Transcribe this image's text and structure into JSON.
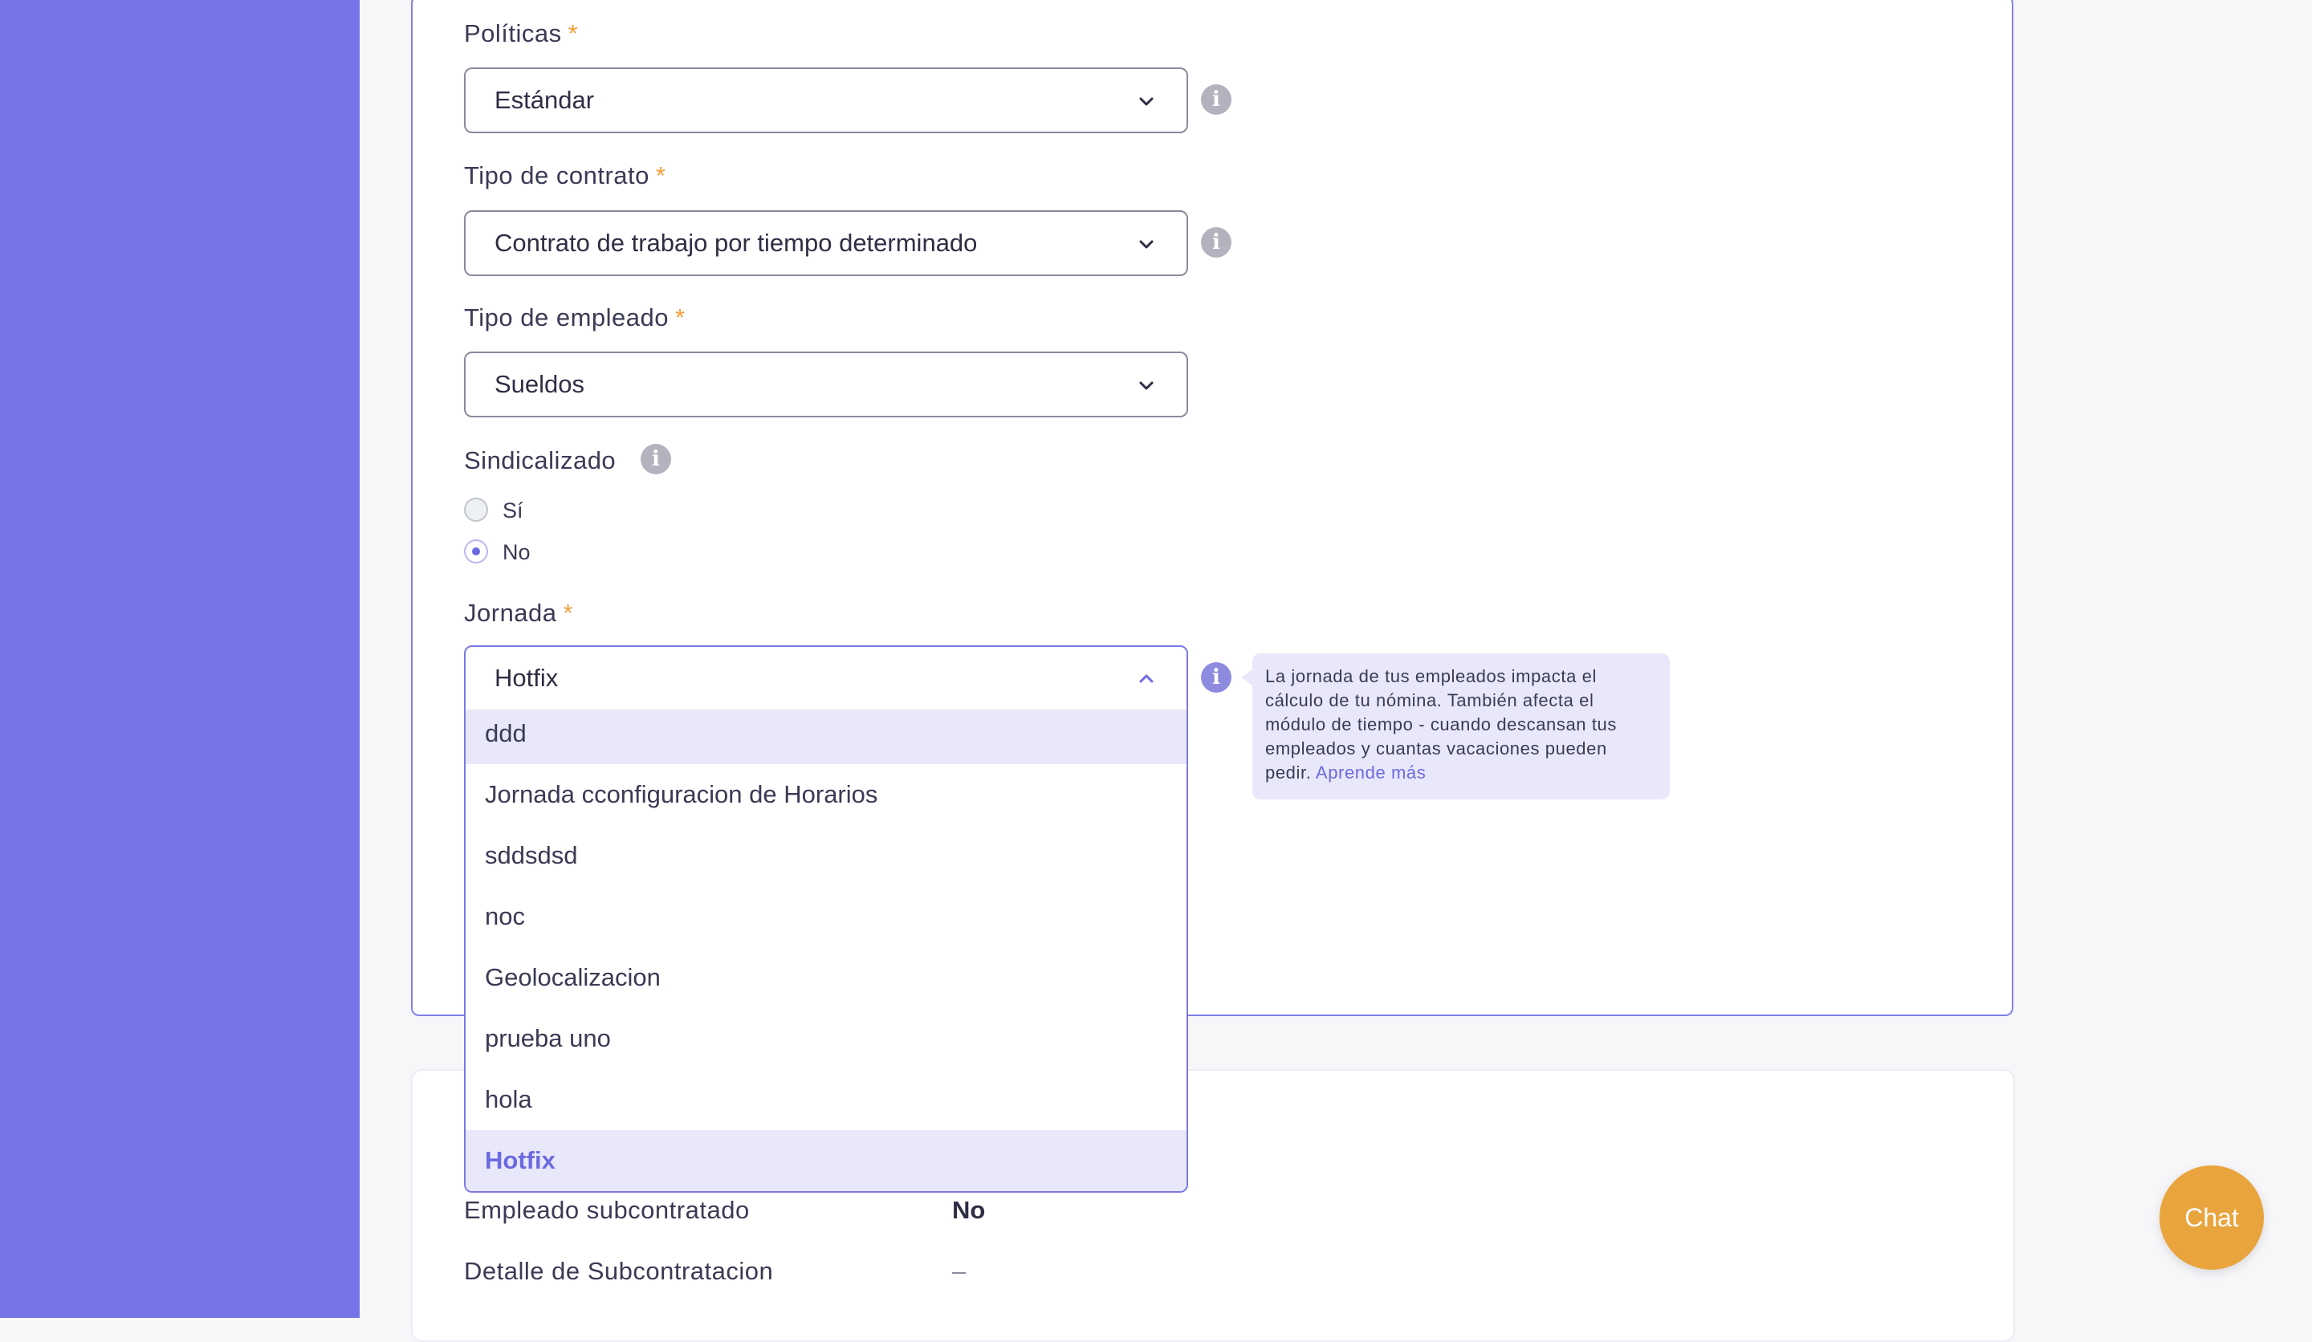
{
  "form": {
    "politicas": {
      "label": "Políticas",
      "required_mark": "*",
      "value": "Estándar",
      "info_icon": "i"
    },
    "tipo_contrato": {
      "label": "Tipo de contrato",
      "required_mark": "*",
      "value": "Contrato de trabajo por tiempo determinado",
      "info_icon": "i"
    },
    "tipo_empleado": {
      "label": "Tipo de empleado",
      "required_mark": "*",
      "value": "Sueldos"
    },
    "sindicalizado": {
      "label": "Sindicalizado",
      "info_icon": "i",
      "options": [
        {
          "label": "Sí",
          "checked": false
        },
        {
          "label": "No",
          "checked": true
        }
      ]
    },
    "jornada": {
      "label": "Jornada",
      "required_mark": "*",
      "value": "Hotfix",
      "info_icon": "i",
      "options": [
        "ddd",
        "Jornada cconfiguracion de Horarios",
        "sddsdsd",
        "noc",
        "Geolocalizacion",
        "prueba uno",
        "hola",
        "Hotfix"
      ],
      "highlighted_option": "ddd",
      "selected_option": "Hotfix",
      "tooltip": {
        "text": "La jornada de tus empleados impacta el cálculo de tu nómina. También afecta el módulo de tiempo - cuando descansan tus empleados y cuantas vacaciones pueden pedir.",
        "link_text": "Aprende más"
      }
    }
  },
  "details": {
    "rows": [
      {
        "label": "Empleado subcontratado",
        "value": "No"
      },
      {
        "label": "Detalle de Subcontratacion",
        "value": "–"
      }
    ]
  },
  "chat": {
    "label": "Chat"
  },
  "icons": {
    "chevron_down": "chevron-down-icon",
    "chevron_up": "chevron-up-icon",
    "info": "info-icon",
    "radio": "radio-icon"
  },
  "colors": {
    "sidebar": "#7673e9",
    "accent": "#6c6ae0",
    "required": "#f2a03d",
    "chat_button": "#e9a43d",
    "highlight": "#e9e8fa"
  }
}
